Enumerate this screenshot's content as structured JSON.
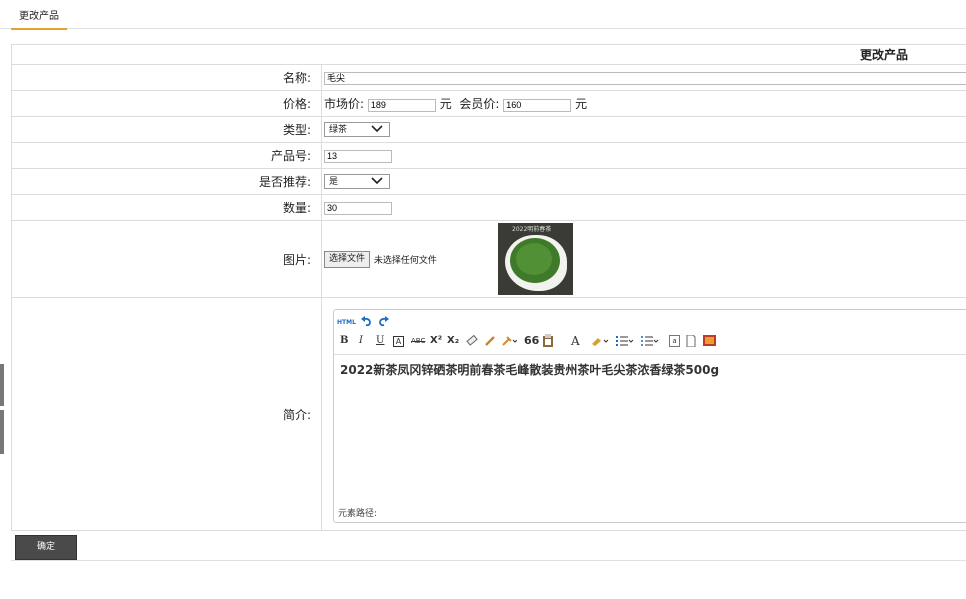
{
  "tabs": [
    {
      "label": "更改产品"
    }
  ],
  "form": {
    "title": "更改产品",
    "name_label": "名称:",
    "name_value": "毛尖",
    "price_label": "价格:",
    "market_price_label": "市场价:",
    "market_price_value": "189",
    "unit1": "元",
    "member_price_label": "会员价:",
    "member_price_value": "160",
    "unit2": "元",
    "type_label": "类型:",
    "type_value": "绿茶",
    "product_no_label": "产品号:",
    "product_no_value": "13",
    "recommend_label": "是否推荐:",
    "recommend_value": "是",
    "quantity_label": "数量:",
    "quantity_value": "30",
    "image_label": "图片:",
    "choose_file_label": "选择文件",
    "no_file_text": "未选择任何文件",
    "image_caption": "2022明前春茶",
    "intro_label": "简介:",
    "editor_content": "2022新茶凤冈锌硒茶明前春茶毛峰散装贵州茶叶毛尖茶浓香绿茶500g",
    "editor_path_label": "元素路径:",
    "submit_label": "确定"
  },
  "editor_toolbar": {
    "html_label": "HTML",
    "bold": "B",
    "italic": "I",
    "underline": "U",
    "quote": "66",
    "font_color": "A",
    "icons": [
      "html-icon",
      "undo-icon",
      "redo-icon",
      "bold-icon",
      "italic-icon",
      "underline-icon",
      "border-icon",
      "strikethrough-icon",
      "superscript-icon",
      "subscript-icon",
      "eraser-icon",
      "format-brush-icon",
      "auto-format-icon",
      "blockquote-icon",
      "paste-plain-icon",
      "font-color-icon",
      "highlight-icon",
      "ordered-list-icon",
      "unordered-list-icon",
      "anchor-icon",
      "new-doc-icon",
      "image-icon"
    ]
  },
  "colors": {
    "tab_accent": "#e8a030",
    "submit_bg": "#4a4a4a",
    "border": "#dcdcdc",
    "undo_blue": "#1e6bc4"
  }
}
